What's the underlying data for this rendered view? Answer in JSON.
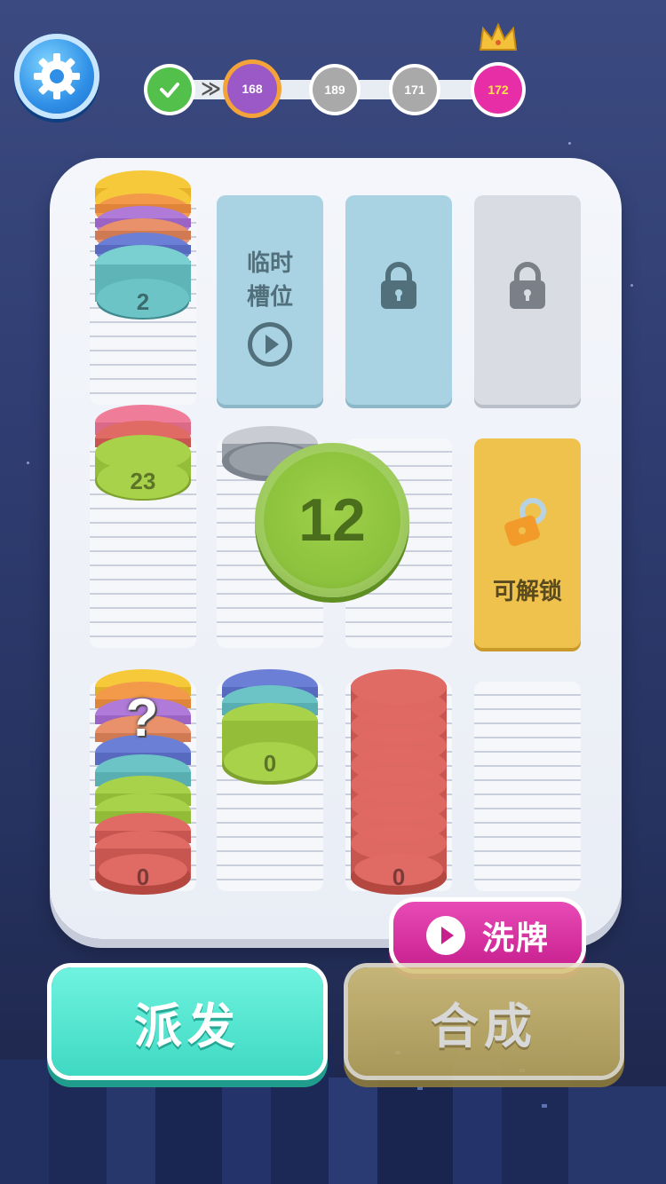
{
  "settings": {
    "icon": "gear-icon"
  },
  "progress": {
    "levels": [
      {
        "label": "",
        "state": "done",
        "icon": "check-icon"
      },
      {
        "label": "168",
        "state": "current"
      },
      {
        "label": "189",
        "state": "locked"
      },
      {
        "label": "171",
        "state": "locked"
      },
      {
        "label": "172",
        "state": "boss",
        "icon": "crown-icon"
      }
    ],
    "arrow": "≫"
  },
  "board": {
    "temp_slot_label_line1": "临时",
    "temp_slot_label_line2": "槽位",
    "unlock_label": "可解锁",
    "stacks": [
      {
        "top_number": "2"
      },
      {
        "top_number": "23"
      },
      {
        "top_number": "?"
      },
      {
        "top_number": "0"
      },
      {
        "top_number": "0"
      },
      {
        "top_number": "0"
      }
    ],
    "floating_chip": "12"
  },
  "buttons": {
    "shuffle": "洗牌",
    "deal": "派发",
    "merge": "合成"
  },
  "colors": {
    "yellow": "#f6c93a",
    "orange": "#f29a4a",
    "purple": "#b07ad8",
    "blue": "#6c7fd6",
    "teal": "#6cc4c6",
    "green": "#a8d24a",
    "red": "#e06a64",
    "pink": "#ef7d9a",
    "deal_button": "#4ee6d0",
    "merge_button": "#c9b46a",
    "shuffle_button": "#d62ea0"
  }
}
